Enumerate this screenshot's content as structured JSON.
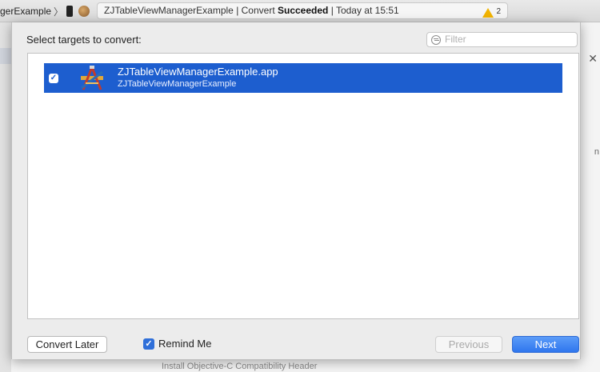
{
  "toolbar": {
    "scheme_name": "gerExample",
    "scheme_sep": "〉",
    "activity_prefix": "ZJTableViewManagerExample | Convert ",
    "activity_status": "Succeeded",
    "activity_suffix": " | Today at 15:51",
    "warning_count": "2"
  },
  "background": {
    "close_glyph": "✕",
    "right_fragment": "n",
    "bottom_fragment": "Install Objective-C Compatibility Header"
  },
  "sheet": {
    "title": "Select targets to convert:",
    "filter_placeholder": "Filter",
    "targets": [
      {
        "checked": true,
        "check_glyph": "✓",
        "name": "ZJTableViewManagerExample.app",
        "subtitle": "ZJTableViewManagerExample",
        "icon": "xcode-app-icon"
      }
    ],
    "convert_later_label": "Convert Later",
    "remind_checked": true,
    "remind_glyph": "✓",
    "remind_label": "Remind Me",
    "previous_label": "Previous",
    "next_label": "Next"
  },
  "colors": {
    "selection": "#1d5ecf",
    "primary_button": "#2f76ee",
    "warning": "#f2b400"
  }
}
